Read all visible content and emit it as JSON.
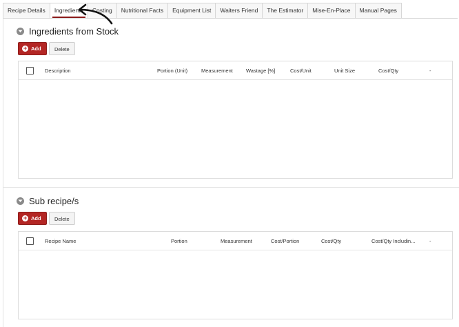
{
  "tabs": [
    {
      "label": "Recipe Details",
      "active": false
    },
    {
      "label": "Ingredients",
      "active": true
    },
    {
      "label": "Costing",
      "active": false
    },
    {
      "label": "Nutritional Facts",
      "active": false
    },
    {
      "label": "Equipment List",
      "active": false
    },
    {
      "label": "Waiters Friend",
      "active": false
    },
    {
      "label": "The Estimator",
      "active": false
    },
    {
      "label": "Mise-En-Place",
      "active": false
    },
    {
      "label": "Manual Pages",
      "active": false
    }
  ],
  "ingredients": {
    "title": "Ingredients from Stock",
    "add_label": "Add",
    "delete_label": "Delete",
    "columns": [
      "Description",
      "Portion (Unit)",
      "Measurement",
      "Wastage [%]",
      "Cost/Unit",
      "Unit Size",
      "Cost/Qty",
      "-"
    ]
  },
  "subrecipes": {
    "title": "Sub recipe/s",
    "add_label": "Add",
    "delete_label": "Delete",
    "columns": [
      "Recipe Name",
      "Portion",
      "Measurement",
      "Cost/Portion",
      "Cost/Qty",
      "Cost/Qty Includin...",
      "-"
    ]
  },
  "colors": {
    "accent": "#b32624",
    "tab_underline": "#8b1a1a"
  },
  "icons": {
    "section_toggle": "chevron-down-icon",
    "add": "plus-circle-icon",
    "annotation": "pointer-arrow-icon"
  }
}
